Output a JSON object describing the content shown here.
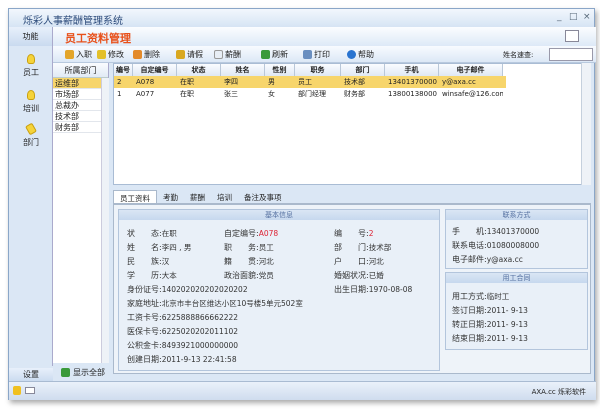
{
  "app": {
    "title": "烁彩人事薪酬管理系统"
  },
  "header": {
    "left": "功能",
    "title": "员工资料管理"
  },
  "toolbar": {
    "items": [
      "入职",
      "修改",
      "删除",
      "请假",
      "薪酬",
      "刷新",
      "打印",
      "帮助"
    ],
    "search_label": "姓名速查:",
    "search_value": ""
  },
  "nav": {
    "items": [
      "员工",
      "培训",
      "部门"
    ],
    "settings": "设置",
    "show_all": "显示全部"
  },
  "departments": {
    "header": "所属部门",
    "items": [
      "运维部",
      "市场部",
      "总裁办",
      "技术部",
      "财务部"
    ],
    "selected": "运维部"
  },
  "grid": {
    "columns": [
      "编号",
      "自定编号",
      "状态",
      "姓名",
      "性别",
      "职务",
      "部门",
      "手机",
      "电子邮件"
    ],
    "rows": [
      [
        "2",
        "A078",
        "在职",
        "李四",
        "男",
        "员工",
        "技术部",
        "13401370000",
        "y@axa.cc"
      ],
      [
        "1",
        "A077",
        "在职",
        "张三",
        "女",
        "部门经理",
        "财务部",
        "13800138000",
        "winsafe@126.com"
      ]
    ]
  },
  "tabs": [
    "员工资料",
    "考勤",
    "薪酬",
    "培训",
    "备注及事项"
  ],
  "basic": {
    "title": "基本信息",
    "fields": [
      [
        "状　　态:",
        "在职"
      ],
      [
        "自定编号:",
        "A078"
      ],
      [
        "编　　号:",
        "2"
      ],
      [
        "姓　　名:",
        "李四 , 男"
      ],
      [
        "职　　务:",
        "员工"
      ],
      [
        "部　　门:",
        "技术部"
      ],
      [
        "民　　族:",
        "汉"
      ],
      [
        "籍　　贯:",
        "河北"
      ],
      [
        "户　　口:",
        "河北"
      ],
      [
        "学　　历:",
        "大本"
      ],
      [
        "政治面貌:",
        "党员"
      ],
      [
        "婚姻状况:",
        "已婚"
      ],
      [
        "身份证号:",
        "140202020202020202"
      ],
      [
        "出生日期:",
        "1970-08-08"
      ],
      [
        "家庭地址:",
        "北京市丰台区维达小区10号楼5单元502室"
      ],
      [
        "工资卡号:",
        "6225888866662222"
      ],
      [
        "医保卡号:",
        "6225020202011102"
      ],
      [
        "公积金卡:",
        "8493921000000000"
      ],
      [
        "创建日期:",
        "2011-9-13 22:41:58"
      ]
    ]
  },
  "contact": {
    "title": "联系方式",
    "fields": [
      [
        "手　　机:",
        "13401370000"
      ],
      [
        "联系电话:",
        "01080008000"
      ],
      [
        "电子邮件:",
        "y@axa.cc"
      ]
    ]
  },
  "contract": {
    "title": "用工合同",
    "fields": [
      [
        "用工方式:",
        "临时工"
      ],
      [
        "签订日期:",
        "2011- 9-13"
      ],
      [
        "转正日期:",
        "2011- 9-13"
      ],
      [
        "结束日期:",
        "2011- 9-13"
      ]
    ]
  },
  "status": {
    "brand": "AXA.cc 烁彩软件"
  },
  "colors": {
    "accent": "#e8501a",
    "selected_row": "#f7d56b",
    "highlight_value": "#d23"
  }
}
